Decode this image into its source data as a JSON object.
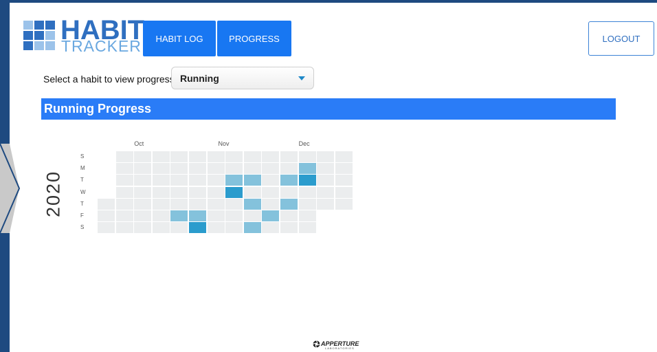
{
  "logo": {
    "title": "HABIT",
    "subtitle": "TRACKER"
  },
  "nav": {
    "habit_log_label": "HABIT LOG",
    "progress_label": "PROGRESS"
  },
  "header": {
    "logout_label": "LOGOUT"
  },
  "habit_select": {
    "label": "Select a habit to view progress:",
    "selected": "Running"
  },
  "progress": {
    "title": "Running Progress"
  },
  "calendar": {
    "year": "2020",
    "months": [
      "Oct",
      "Nov",
      "Dec"
    ],
    "weekdays": [
      "S",
      "M",
      "T",
      "W",
      "T",
      "F",
      "S"
    ],
    "level_colors": [
      "#ebedee",
      "#84c2dc",
      "#2b9ccd"
    ]
  },
  "footer": {
    "brand": "APPERTURE",
    "tagline": "LABORATORIES"
  },
  "colors": {
    "accent": "#1877f2",
    "banner": "#2a7cf7",
    "page_border": "#1e4a80"
  }
}
